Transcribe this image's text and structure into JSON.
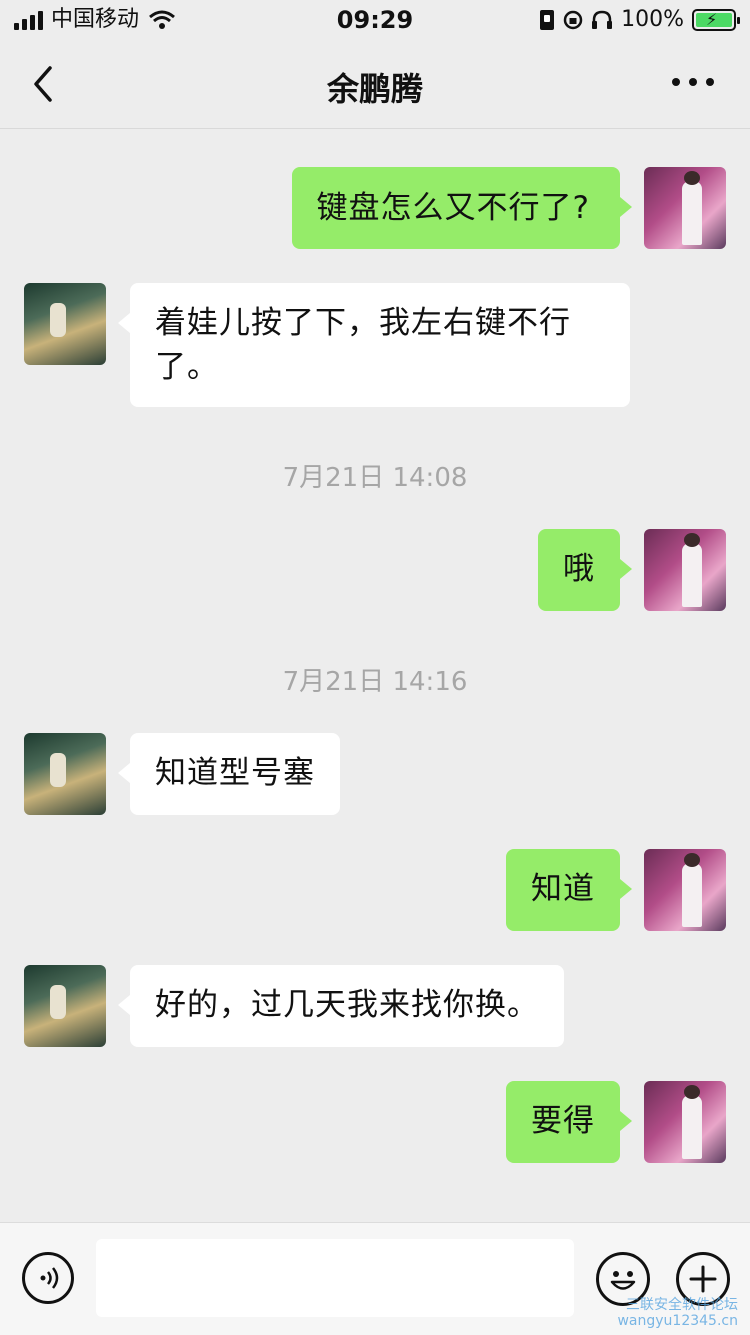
{
  "status_bar": {
    "carrier": "中国移动",
    "time": "09:29",
    "battery": "100%"
  },
  "header": {
    "title": "余鹏腾",
    "back_icon": "chevron-left-icon",
    "more_icon": "more-dots-icon"
  },
  "messages": [
    {
      "side": "me",
      "text": "键盘怎么又不行了?"
    },
    {
      "side": "them",
      "text": "着娃儿按了下，我左右键不行了。"
    },
    {
      "timestamp": "7月21日 14:08"
    },
    {
      "side": "me",
      "text": "哦"
    },
    {
      "timestamp": "7月21日 14:16"
    },
    {
      "side": "them",
      "text": "知道型号塞"
    },
    {
      "side": "me",
      "text": "知道"
    },
    {
      "side": "them",
      "text": "好的，过几天我来找你换。"
    },
    {
      "side": "me",
      "text": "要得"
    }
  ],
  "input_bar": {
    "voice_icon": "voice-icon",
    "emoji_icon": "emoji-icon",
    "plus_icon": "plus-icon",
    "input_value": ""
  },
  "watermark": {
    "line1": "三联安全软件论坛",
    "line2": "wangyu12345.cn"
  }
}
